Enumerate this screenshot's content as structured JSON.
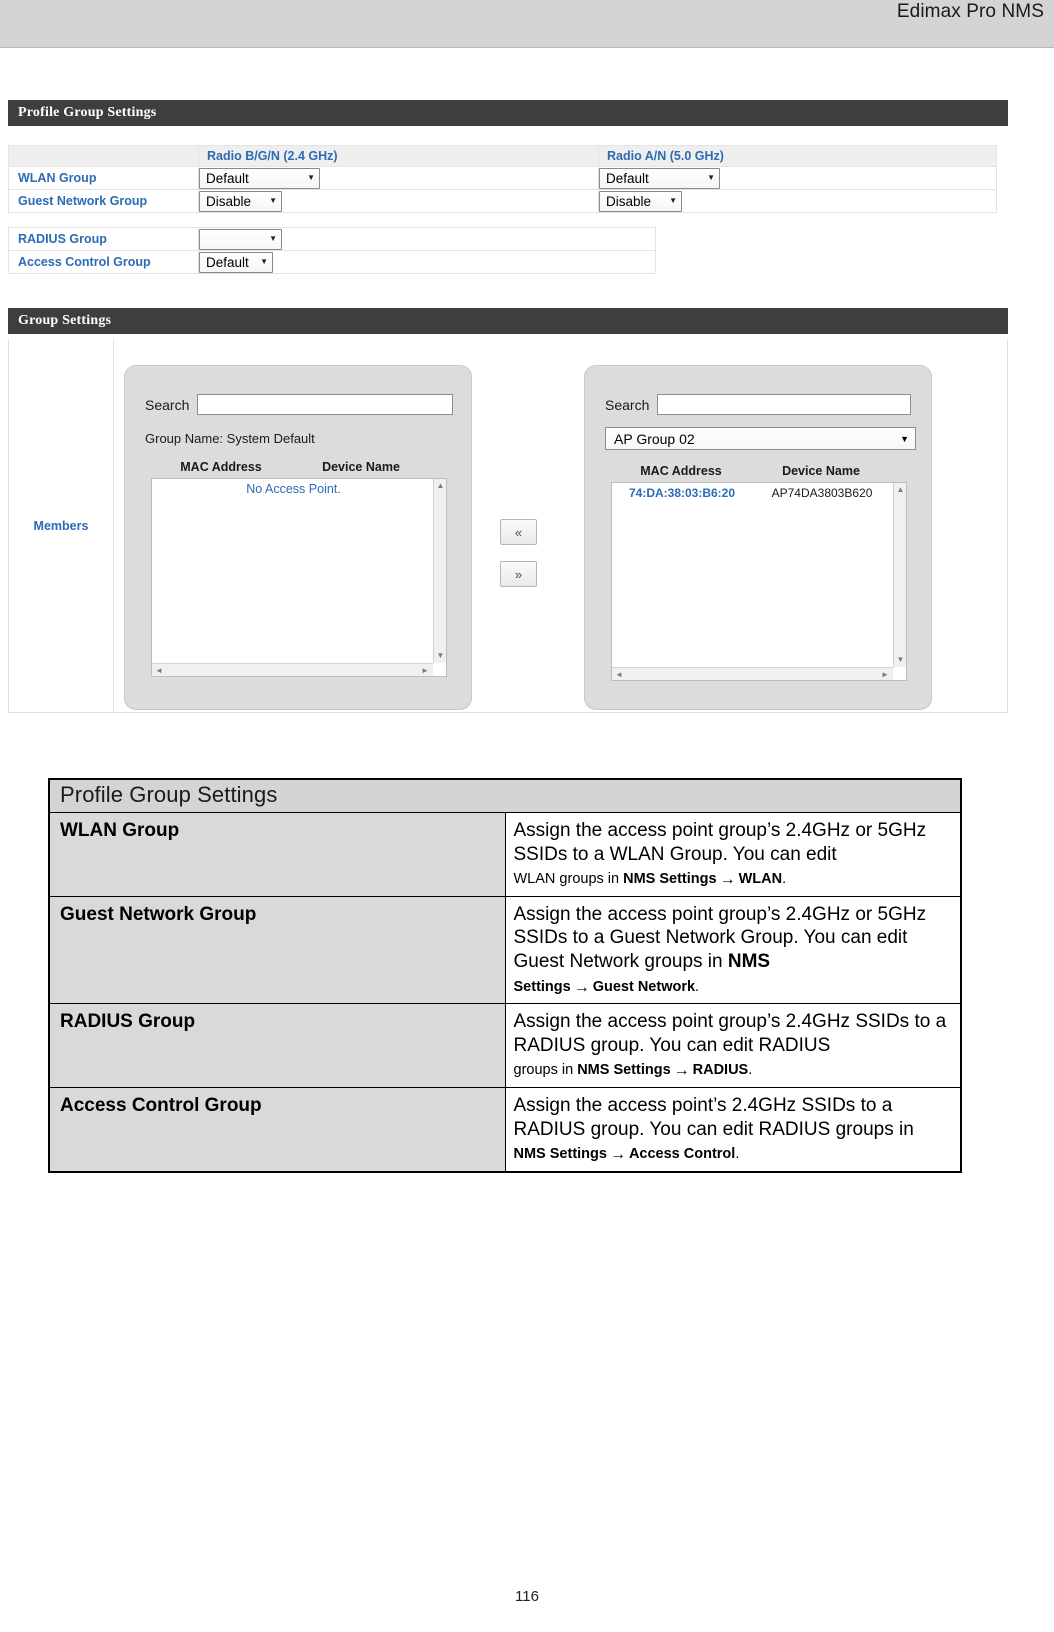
{
  "page": {
    "header_title": "Edimax Pro NMS",
    "page_number": "116"
  },
  "profile_panel": {
    "bar_title": "Profile Group Settings",
    "columns": {
      "radio_24": "Radio B/G/N (2.4 GHz)",
      "radio_50": "Radio A/N (5.0 GHz)"
    },
    "rows": [
      {
        "label": "WLAN Group",
        "value_24": "Default",
        "value_50": "Default"
      },
      {
        "label": "Guest Network Group",
        "value_24": "Disable",
        "value_50": "Disable"
      }
    ],
    "rows2": [
      {
        "label": "RADIUS Group",
        "value": ""
      },
      {
        "label": "Access Control Group",
        "value": "Default"
      }
    ],
    "caret": "▼"
  },
  "group_panel": {
    "bar_title": "Group Settings",
    "members_label": "Members",
    "left": {
      "search_label": "Search",
      "search_value": "",
      "group_name_line": "Group Name: System Default",
      "col_mac": "MAC Address",
      "col_device": "Device Name",
      "empty_text": "No Access Point.",
      "items": []
    },
    "right": {
      "search_label": "Search",
      "search_value": "",
      "selected_group": "AP Group 02",
      "col_mac": "MAC Address",
      "col_device": "Device Name",
      "items": [
        {
          "mac": "74:DA:38:03:B6:20",
          "device": "AP74DA3803B620"
        }
      ]
    },
    "transfer": {
      "move_left": "«",
      "move_right": "»"
    },
    "caret": "▼",
    "scroll": {
      "up": "▲",
      "down": "▼",
      "left": "◄",
      "right": "►"
    }
  },
  "doc_table": {
    "title": "Profile Group Settings",
    "rows": [
      {
        "key": "WLAN Group",
        "desc_main": "Assign the access point group’s 2.4GHz or 5GHz SSIDs to a WLAN Group. You can edit ",
        "desc_small_pre": "WLAN groups in ",
        "desc_small_bold1": "NMS Settings",
        "arrow": "→",
        "desc_small_bold2": "WLAN",
        "desc_small_post": "."
      },
      {
        "key": "Guest Network Group",
        "desc_main": "Assign the access point group’s 2.4GHz or 5GHz SSIDs to a Guest Network Group. You can edit Guest Network groups in ",
        "desc_main_bold": "NMS",
        "desc_small_pre": "",
        "desc_small_bold1": "Settings",
        "arrow": "→",
        "desc_small_bold2": "Guest Network",
        "desc_small_post": "."
      },
      {
        "key": "RADIUS Group",
        "desc_main": "Assign the access point group’s 2.4GHz SSIDs to a RADIUS group. You can edit RADIUS ",
        "desc_small_pre": "groups in ",
        "desc_small_bold1": "NMS Settings",
        "arrow": "→",
        "desc_small_bold2": "RADIUS",
        "desc_small_post": "."
      },
      {
        "key": "Access Control Group",
        "desc_main": "Assign the access point’s 2.4GHz SSIDs to a RADIUS group. You can edit RADIUS groups in ",
        "desc_small_pre": "",
        "desc_small_bold1": "NMS Settings",
        "arrow": "→",
        "desc_small_bold2": "Access Control",
        "desc_small_post": "."
      }
    ]
  }
}
